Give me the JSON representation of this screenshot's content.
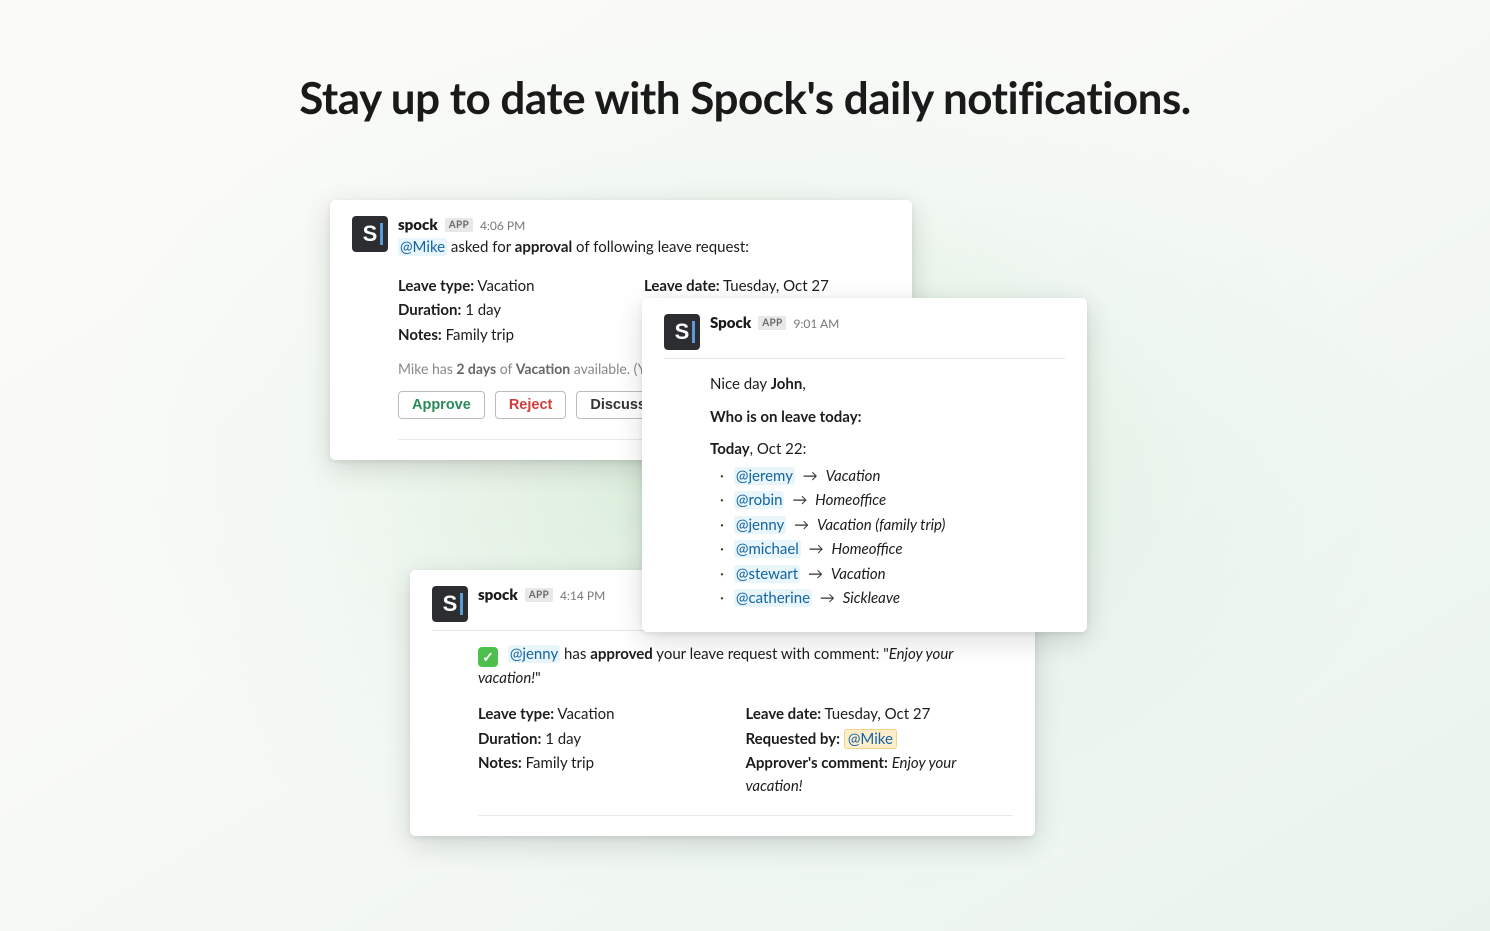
{
  "headline": "Stay up to date with Spock's daily notifications.",
  "avatar_letter": "S",
  "app_badge": "APP",
  "card_approval": {
    "app_name": "spock",
    "time": "4:06 PM",
    "mention": "@Mike",
    "line_mid": " asked for ",
    "line_strong": "approval",
    "line_end": " of following leave request:",
    "leave_type_label": "Leave type:",
    "leave_type_value": "Vacation",
    "duration_label": "Duration:",
    "duration_value": "1 day",
    "notes_label": "Notes:",
    "notes_value": "Family trip",
    "leave_date_label": "Leave date:",
    "leave_date_value": "Tuesday, Oct 27",
    "avail_pre": "Mike has ",
    "avail_days": "2 days",
    "avail_mid": " of ",
    "avail_type": "Vacation",
    "avail_post": " available. (Yea",
    "btn_approve": "Approve",
    "btn_reject": "Reject",
    "btn_discuss": "Discuss"
  },
  "card_daily": {
    "app_name": "Spock",
    "time": "9:01 AM",
    "greet_pre": "Nice day ",
    "greet_name": "John",
    "greet_post": ",",
    "heading": "Who is on leave today:",
    "today_strong": "Today",
    "today_rest": ", Oct 22:",
    "items": [
      {
        "mention": "@jeremy",
        "type": "Vacation",
        "note": ""
      },
      {
        "mention": "@robin",
        "type": "Homeoffice",
        "note": ""
      },
      {
        "mention": "@jenny",
        "type": "Vacation",
        "note": "(family trip)"
      },
      {
        "mention": "@michael",
        "type": "Homeoffice",
        "note": ""
      },
      {
        "mention": "@stewart",
        "type": "Vacation",
        "note": ""
      },
      {
        "mention": "@catherine",
        "type": "Sickleave",
        "note": ""
      }
    ]
  },
  "card_approved": {
    "app_name": "spock",
    "time": "4:14 PM",
    "mention": "@jenny",
    "line_mid1": " has ",
    "line_strong": "approved",
    "line_mid2": " your leave request with comment: \"",
    "comment": "Enjoy your vacation!",
    "line_end": "\"",
    "leave_type_label": "Leave type:",
    "leave_type_value": "Vacation",
    "duration_label": "Duration:",
    "duration_value": "1 day",
    "notes_label": "Notes:",
    "notes_value": "Family trip",
    "leave_date_label": "Leave date:",
    "leave_date_value": "Tuesday, Oct 27",
    "requested_by_label": "Requested by:",
    "requested_by_value": "@Mike",
    "approver_comment_label": "Approver's comment:",
    "approver_comment_value": "Enjoy your vacation!"
  }
}
